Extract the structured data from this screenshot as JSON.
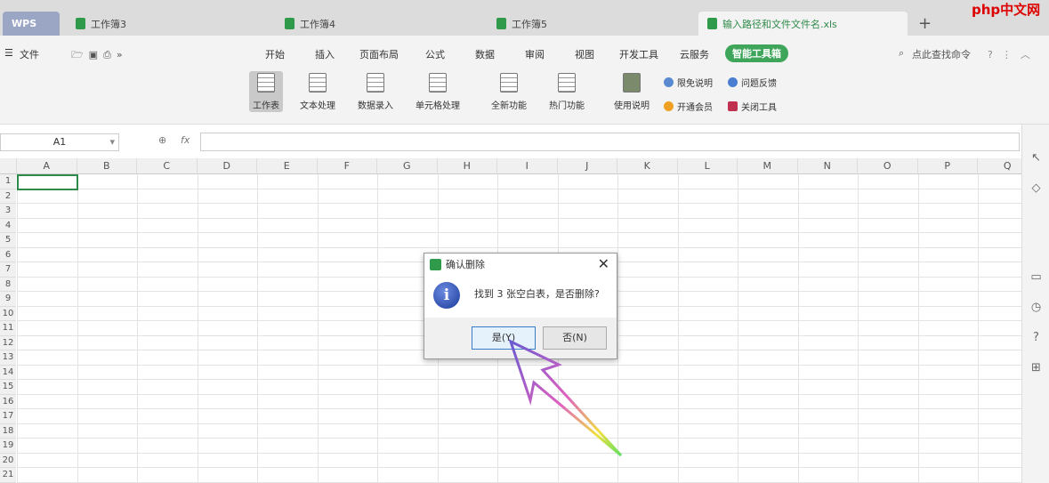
{
  "tabs": {
    "wps": "WPS",
    "items": [
      "工作簿3",
      "工作簿4",
      "工作簿5",
      "输入路径和文件文件名.xls"
    ],
    "new": "+"
  },
  "menu": {
    "file": "文件",
    "items": [
      "开始",
      "插入",
      "页面布局",
      "公式",
      "数据",
      "审阅",
      "视图",
      "开发工具",
      "云服务"
    ],
    "smart": "智能工具箱",
    "search": "点此查找命令"
  },
  "ribbon": {
    "big": [
      "工作表",
      "文本处理",
      "数据录入",
      "单元格处理",
      "全新功能",
      "热门功能",
      "使用说明"
    ],
    "small": [
      "限免说明",
      "问题反馈",
      "开通会员",
      "关闭工具"
    ]
  },
  "formula": {
    "cell": "A1",
    "fx": "fx"
  },
  "columns": [
    "A",
    "B",
    "C",
    "D",
    "E",
    "F",
    "G",
    "H",
    "I",
    "J",
    "K",
    "L",
    "M",
    "N",
    "O",
    "P",
    "Q"
  ],
  "rows": [
    "1",
    "2",
    "3",
    "4",
    "5",
    "6",
    "7",
    "8",
    "9",
    "10",
    "11",
    "12",
    "13",
    "14",
    "15",
    "16",
    "17",
    "18",
    "19",
    "20",
    "21"
  ],
  "dialog": {
    "title": "确认删除",
    "message": "找到 3 张空白表，是否删除?",
    "yes": "是(Y)",
    "no": "否(N)"
  },
  "watermark": "php中文网"
}
